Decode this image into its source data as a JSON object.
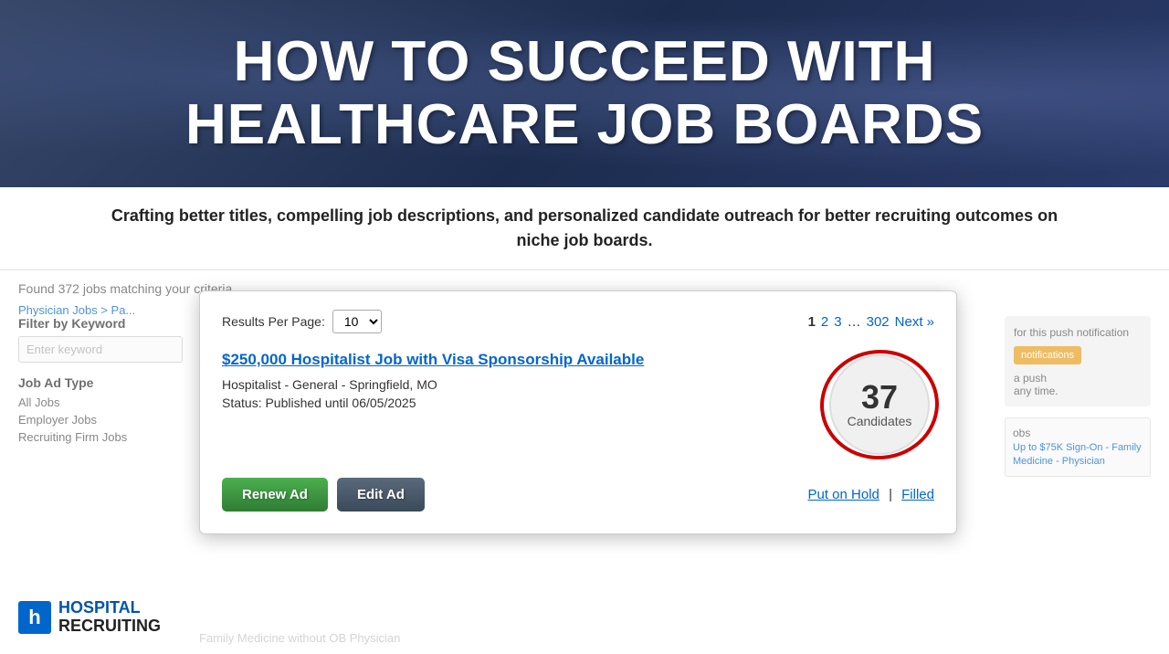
{
  "header": {
    "title_line1": "HOW TO SUCCEED WITH",
    "title_line2": "HEALTHCARE JOB BOARDS",
    "subtitle": "Crafting better titles, compelling job descriptions, and personalized candidate outreach for better recruiting outcomes on niche job boards."
  },
  "background": {
    "found_text": "Found 372 jobs matching your criteria",
    "breadcrumb": "Physician Jobs > Pa...",
    "sidebar": {
      "filter_label": "Filter by Keyword",
      "filter_placeholder": "Enter keyword",
      "job_ad_type_label": "Job Ad Type",
      "links": [
        "All Jobs",
        "Employer Jobs",
        "Recruiting Firm Jobs"
      ]
    }
  },
  "modal": {
    "results_per_page_label": "Results Per Page:",
    "results_per_page_value": "10",
    "pagination": {
      "current": "1",
      "pages": [
        "2",
        "3"
      ],
      "dots": "…",
      "last_page": "302",
      "next_label": "Next »"
    },
    "job": {
      "title": "$250,000 Hospitalist Job with Visa Sponsorship Available",
      "location": "Hospitalist - General - Springfield, MO",
      "status": "Status: Published until 06/05/2025",
      "candidates_count": "37",
      "candidates_label": "Candidates"
    },
    "buttons": {
      "renew_label": "Renew Ad",
      "edit_label": "Edit Ad"
    },
    "secondary_links": {
      "put_on_hold": "Put on Hold",
      "separator": "|",
      "filled": "Filled"
    }
  },
  "logo": {
    "icon_letter": "h",
    "text_hospital": "HOSPITAL",
    "text_recruiting": "RECRUITING"
  },
  "bottom_job_text": "Family Medicine without OB Physician"
}
